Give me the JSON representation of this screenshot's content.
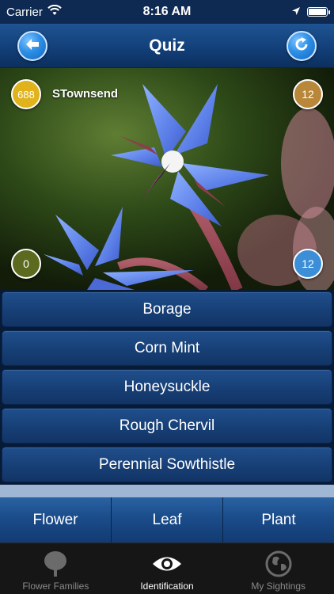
{
  "status_bar": {
    "carrier": "Carrier",
    "time": "8:16 AM",
    "battery_level": 1.0
  },
  "nav": {
    "title": "Quiz",
    "back_icon": "arrow-left-icon",
    "refresh_icon": "refresh-icon"
  },
  "quiz": {
    "user_score": "688",
    "username": "STownsend",
    "questions_total": "12",
    "wrong_count": "0",
    "right_count": "12"
  },
  "answers": [
    {
      "label": "Borage"
    },
    {
      "label": "Corn Mint"
    },
    {
      "label": "Honeysuckle"
    },
    {
      "label": "Rough Chervil"
    },
    {
      "label": "Perennial Sowthistle"
    }
  ],
  "categories": [
    {
      "label": "Flower"
    },
    {
      "label": "Leaf"
    },
    {
      "label": "Plant"
    }
  ],
  "tabs": [
    {
      "label": "Flower Families",
      "icon": "tree-icon",
      "active": false
    },
    {
      "label": "Identification",
      "icon": "eye-icon",
      "active": true
    },
    {
      "label": "My Sightings",
      "icon": "globe-icon",
      "active": false
    }
  ],
  "colors": {
    "nav_blue": "#13407a",
    "answer_blue": "#173f76",
    "score_badge": "#e0b21c",
    "total_badge": "#b8873a",
    "wrong_badge": "#5b6a1e",
    "right_badge": "#3c8fd6"
  }
}
